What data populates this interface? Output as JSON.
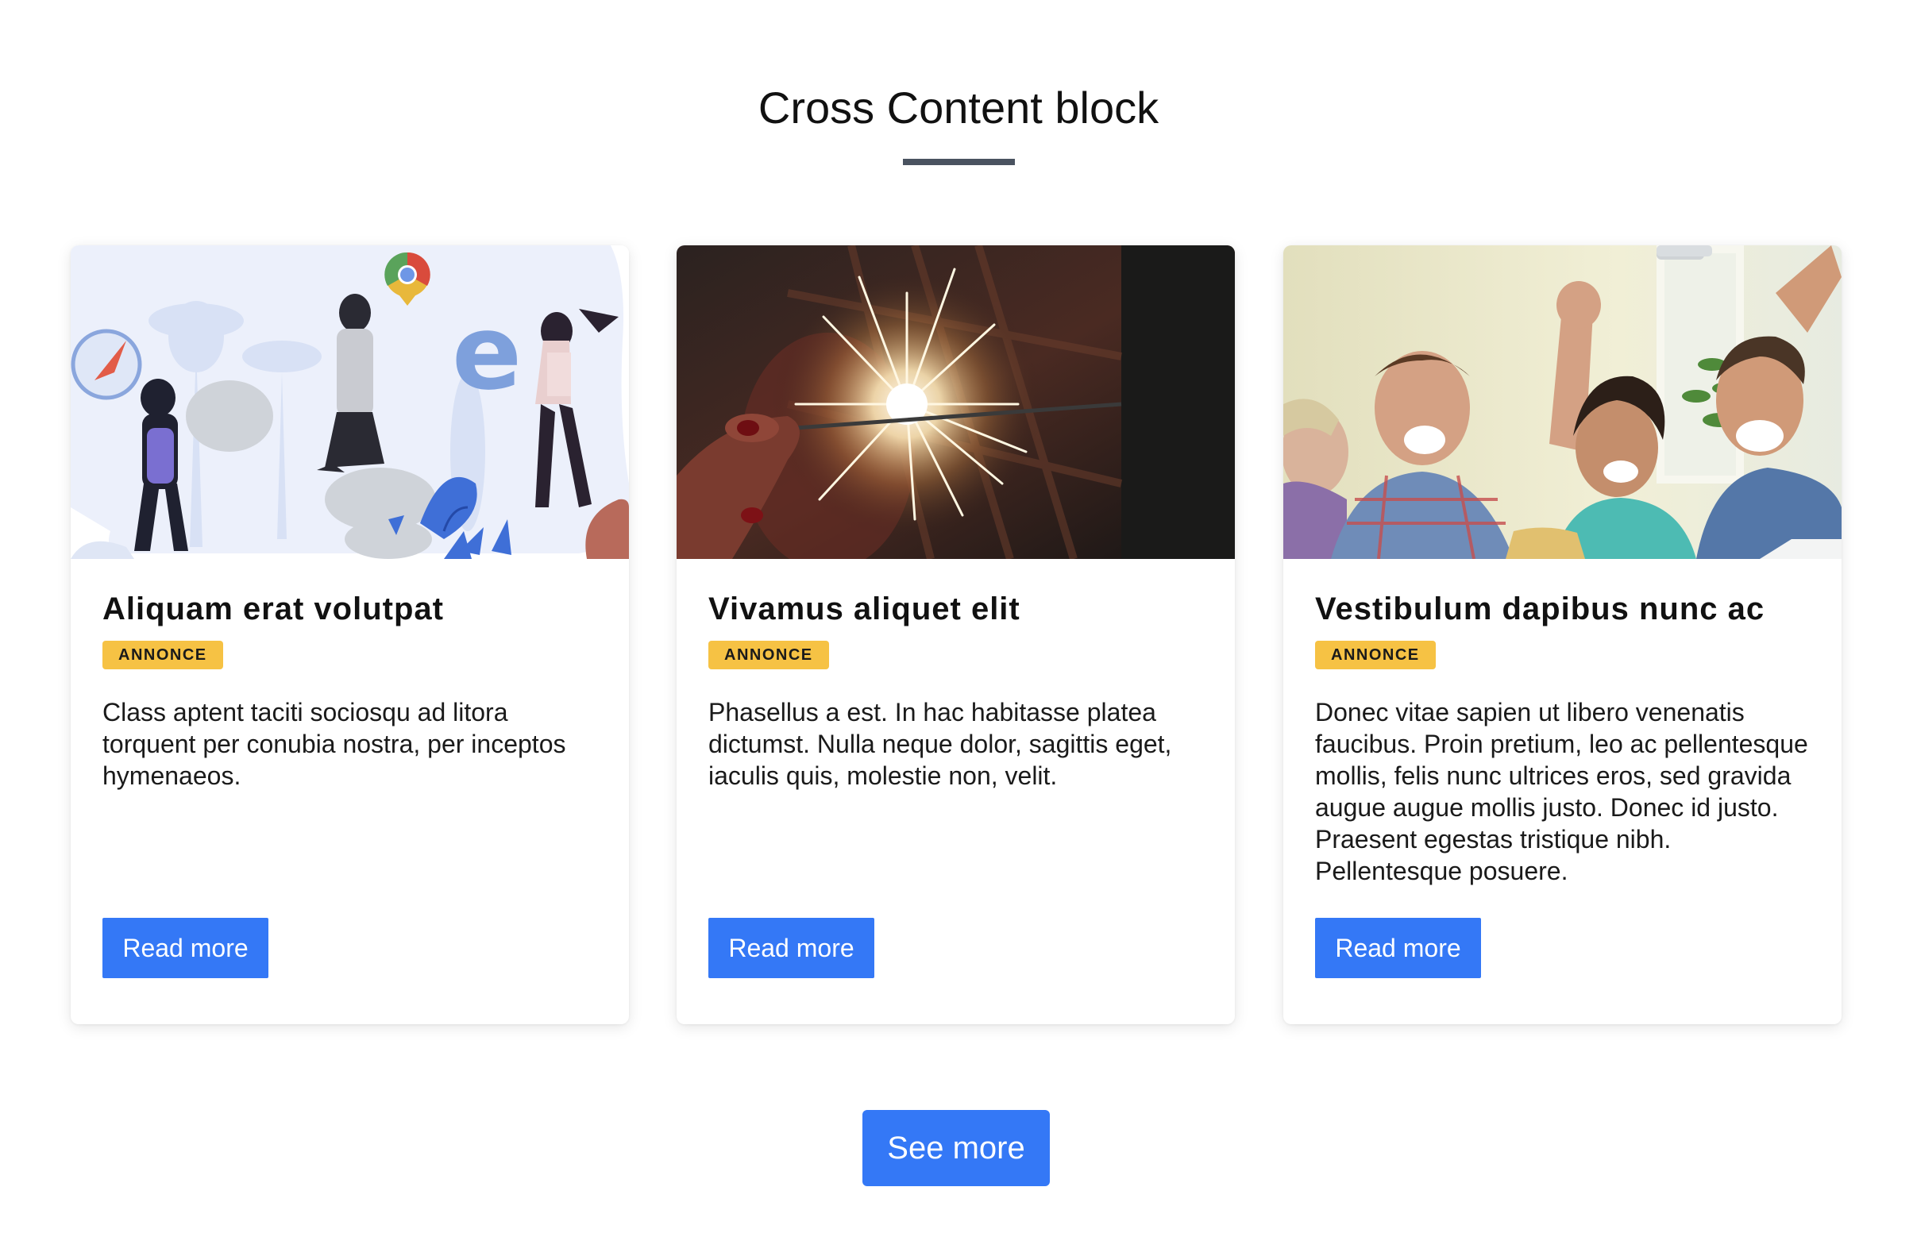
{
  "section": {
    "title": "Cross Content block"
  },
  "cards": [
    {
      "title": "Aliquam erat volutpat",
      "badge": "ANNONCE",
      "text": "Class aptent taciti sociosqu ad litora torquent per conubia nostra, per inceptos hymenaeos.",
      "cta": "Read more",
      "image": "browser-illustration-image"
    },
    {
      "title": "Vivamus aliquet elit",
      "badge": "ANNONCE",
      "text": "Phasellus a est. In hac habitasse platea dictumst. Nulla neque dolor, sagittis eget, iaculis quis, molestie non, velit.",
      "cta": "Read more",
      "image": "sparkler-photo"
    },
    {
      "title": "Vestibulum dapibus nunc ac",
      "badge": "ANNONCE",
      "text": "Donec vitae sapien ut libero venenatis faucibus. Proin pretium, leo ac pellentesque mollis, felis nunc ultrices eros, sed gravida augue augue mollis justo. Donec id justo. Praesent egestas tristique nibh. Pellentesque posuere.",
      "cta": "Read more",
      "image": "friends-selfie-photo"
    }
  ],
  "footer": {
    "see_more": "See more"
  },
  "colors": {
    "primary_button": "#3478f6",
    "badge": "#f6c244",
    "title_underline": "#4a5360"
  }
}
